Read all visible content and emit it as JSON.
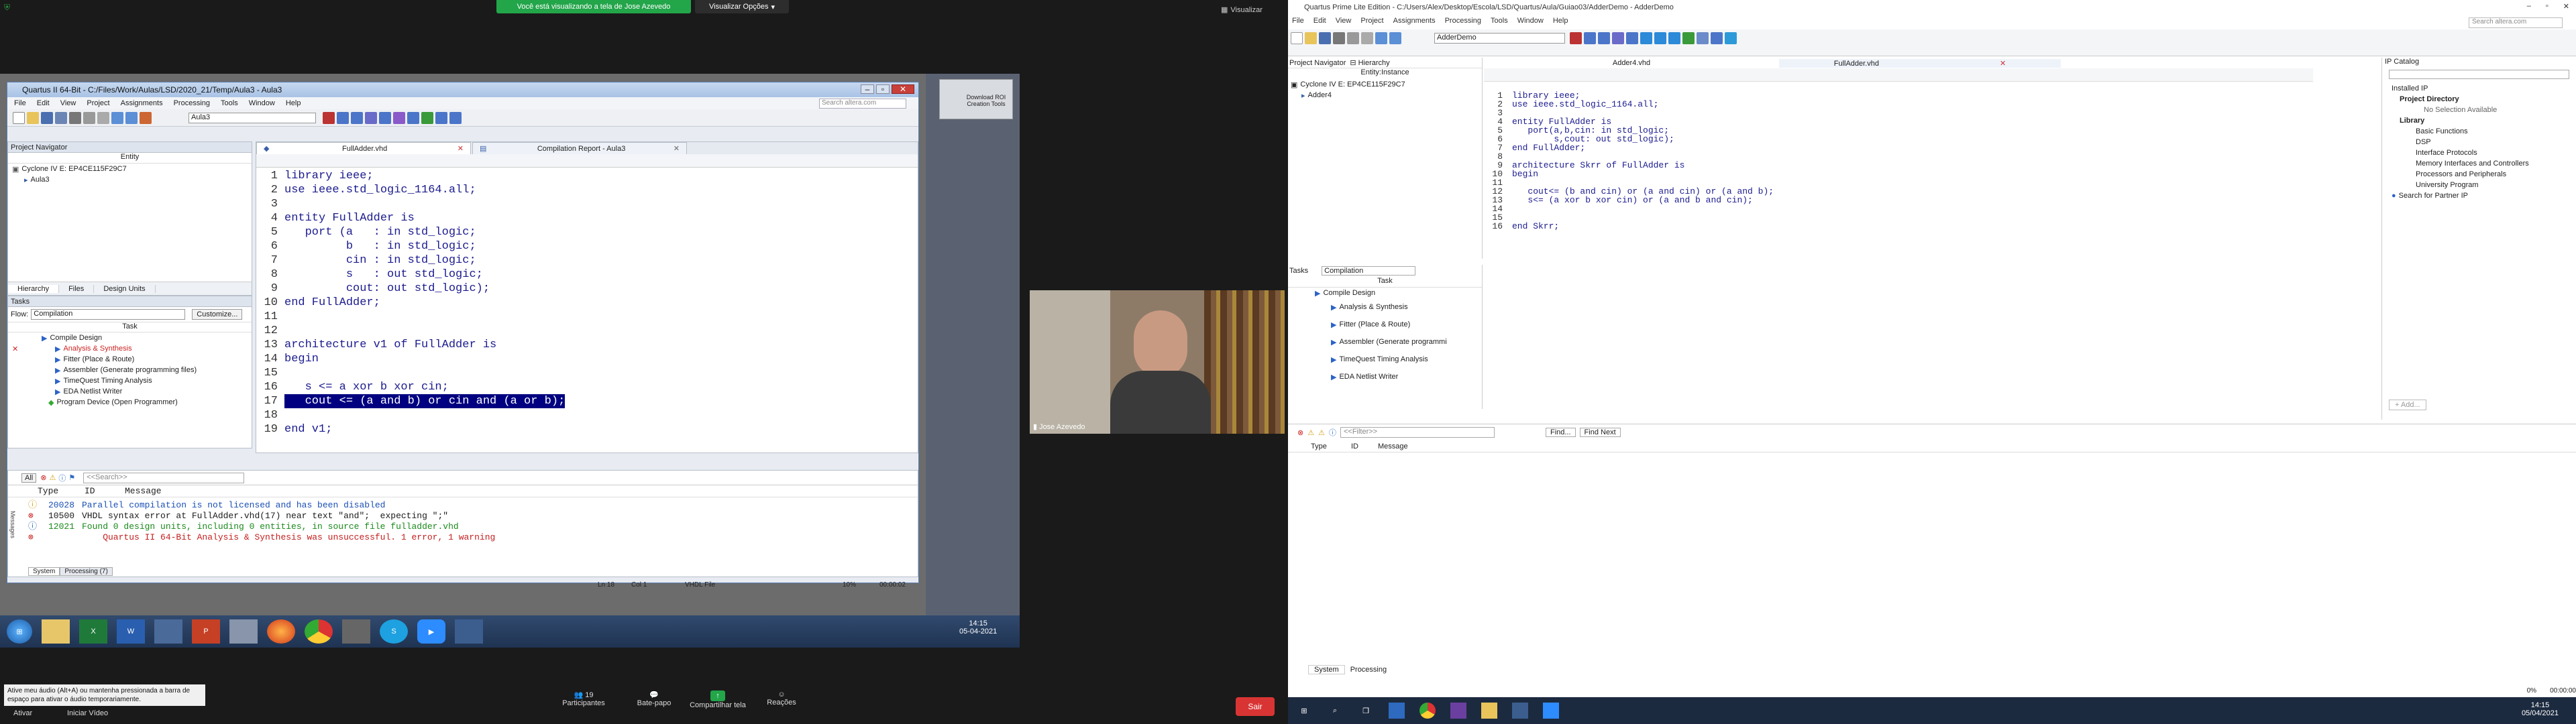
{
  "zoom": {
    "share_banner": "Você está visualizando a tela de Jose Azevedo",
    "view_options": "Visualizar Opções",
    "view_right": "Visualizar",
    "participant_name": "Jose Azevedo",
    "tip": "Ative meu áudio (Alt+A) ou mantenha pressionada a barra de espaço para ativar o áudio temporariamente.",
    "controls": [
      {
        "label": "Ativar",
        "icon": "mic-icon"
      },
      {
        "label": "Iniciar Vídeo",
        "icon": "video-icon"
      },
      {
        "label": "Participantes",
        "icon": "participants-icon",
        "count": "19"
      },
      {
        "label": "Bate-papo",
        "icon": "chat-icon"
      },
      {
        "label": "Compartilhar tela",
        "icon": "share-icon"
      },
      {
        "label": "Reações",
        "icon": "reactions-icon"
      }
    ],
    "leave": "Sair"
  },
  "q2": {
    "title": "Quartus II 64-Bit - C:/Files/Work/Aulas/LSD/2020_21/Temp/Aula3 - Aula3",
    "menu": [
      "File",
      "Edit",
      "View",
      "Project",
      "Assignments",
      "Processing",
      "Tools",
      "Window",
      "Help"
    ],
    "search_placeholder": "Search altera.com",
    "top_entity": "Aula3",
    "project_navigator": "Project Navigator",
    "entity_header": "Entity",
    "device": "Cyclone IV E: EP4CE115F29C7",
    "entity": "Aula3",
    "nav_tabs": [
      "Hierarchy",
      "Files",
      "Design Units"
    ],
    "tasks_title": "Tasks",
    "flow_label": "Flow:",
    "flow_value": "Compilation",
    "customize": "Customize...",
    "task_header": "Task",
    "tasks": [
      "Compile Design",
      "Analysis & Synthesis",
      "Fitter (Place & Route)",
      "Assembler (Generate programming files)",
      "TimeQuest Timing Analysis",
      "EDA Netlist Writer",
      "Program Device (Open Programmer)"
    ],
    "editor_tabs": [
      "FullAdder.vhd",
      "Compilation Report - Aula3"
    ],
    "code_lines": [
      "library ieee;",
      "use ieee.std_logic_1164.all;",
      "",
      "entity FullAdder is",
      "   port (a   : in std_logic;",
      "         b   : in std_logic;",
      "         cin : in std_logic;",
      "         s   : out std_logic;",
      "         cout: out std_logic);",
      "end FullAdder;",
      "",
      "",
      "architecture v1 of FullAdder is",
      "begin",
      "",
      "   s <= a xor b xor cin;",
      "   cout <= (a and b) or cin and (a or b);",
      "",
      "end v1;"
    ],
    "msg_headers": [
      "Type",
      "ID",
      "Message"
    ],
    "filter_placeholder": "<<Search>>",
    "all_label": "All",
    "messages": [
      {
        "id": "20028",
        "text": "Parallel compilation is not licensed and has been disabled",
        "color": "#1a4fb5"
      },
      {
        "id": "10500",
        "text": "VHDL syntax error at FullAdder.vhd(17) near text \"and\";  expecting \";\"",
        "color": "#1a1a1a"
      },
      {
        "id": "12021",
        "text": "Found 0 design units, including 0 entities, in source file fulladder.vhd",
        "color": "#1a8a1a"
      },
      {
        "id": "",
        "text": "Quartus II 64-Bit Analysis & Synthesis was unsuccessful. 1 error, 1 warning",
        "color": "#c41e1e"
      }
    ],
    "msg_tabs": [
      "System",
      "Processing (7)"
    ],
    "status": {
      "line": "Ln 18",
      "col": "Col 1",
      "type": "VHDL File",
      "zoom": "10%",
      "time": "00:00:02"
    },
    "clock_time": "14:15",
    "clock_date": "05-04-2021",
    "download_label": "Download ROI Creation Tools"
  },
  "qp": {
    "title": "Quartus Prime Lite Edition - C:/Users/Alex/Desktop/Escola/LSD/Quartus/Aula/Guiao03/AdderDemo - AdderDemo",
    "menu": [
      "File",
      "Edit",
      "View",
      "Project",
      "Assignments",
      "Processing",
      "Tools",
      "Window",
      "Help"
    ],
    "search_placeholder": "Search altera.com",
    "revision": "AdderDemo",
    "nav_title": "Project Navigator",
    "nav_mode": "Hierarchy",
    "entity_header": "Entity:Instance",
    "device": "Cyclone IV E: EP4CE115F29C7",
    "entity": "Adder4",
    "tasks_title": "Tasks",
    "flow_value": "Compilation",
    "task_header": "Task",
    "tasks": [
      "Compile Design",
      "Analysis & Synthesis",
      "Fitter (Place & Route)",
      "Assembler (Generate programmi",
      "TimeQuest Timing Analysis",
      "EDA Netlist Writer"
    ],
    "editor_tabs": [
      "Adder4.vhd",
      "FullAdder.vhd"
    ],
    "code_lines": [
      "library ieee;",
      "use ieee.std_logic_1164.all;",
      "",
      "entity FullAdder is",
      "   port(a,b,cin: in std_logic;",
      "        s,cout: out std_logic);",
      "end FullAdder;",
      "",
      "architecture Skrr of FullAdder is",
      "begin",
      "",
      "   cout<= (b and cin) or (a and cin) or (a and b);",
      "   s<= (a xor b xor cin) or (a and b and cin);",
      "",
      "",
      "end Skrr;"
    ],
    "ip": {
      "title": "IP Catalog",
      "installed": "Installed IP",
      "project_dir": "Project Directory",
      "no_selection": "No Selection Available",
      "library": "Library",
      "items": [
        "Basic Functions",
        "DSP",
        "Interface Protocols",
        "Memory Interfaces and Controllers",
        "Processors and Peripherals",
        "University Program"
      ],
      "search_partner": "Search for Partner IP",
      "add": "+ Add..."
    },
    "msg_headers": [
      "Type",
      "ID",
      "Message"
    ],
    "filter_placeholder": "<<Filter>>",
    "find": "Find...",
    "find_next": "Find Next",
    "msg_tabs": [
      "System",
      "Processing"
    ],
    "status_percent": "0%",
    "status_time": "00:00:00",
    "clock_time": "14:15",
    "clock_date": "05/04/2021"
  }
}
